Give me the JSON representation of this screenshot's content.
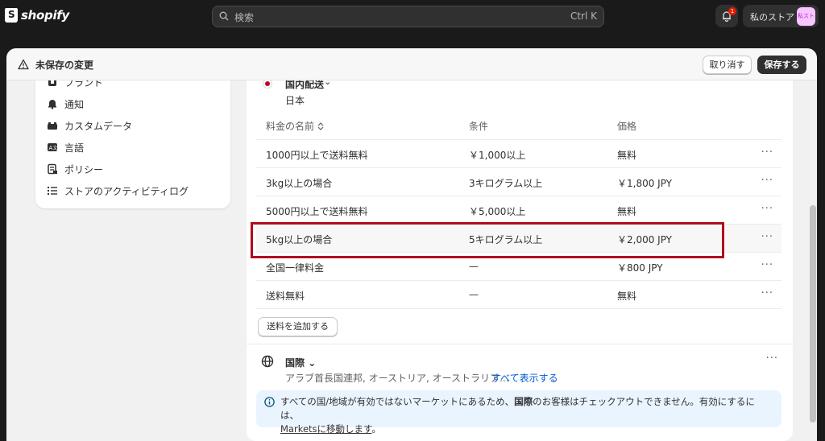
{
  "topbar": {
    "logo_text": "shopify",
    "search_placeholder": "検索",
    "search_shortcut": "Ctrl K",
    "notification_count": "1",
    "store_name": "私のストア",
    "store_avatar": "私スト"
  },
  "unsaved": {
    "title": "未保存の変更",
    "discard_label": "取り消す",
    "save_label": "保存する"
  },
  "sidebar": {
    "items": [
      {
        "label": "ブランド",
        "icon": "brand-icon"
      },
      {
        "label": "通知",
        "icon": "bell-icon"
      },
      {
        "label": "カスタムデータ",
        "icon": "custom-data-icon"
      },
      {
        "label": "言語",
        "icon": "language-icon"
      },
      {
        "label": "ポリシー",
        "icon": "policy-icon"
      },
      {
        "label": "ストアのアクティビティログ",
        "icon": "list-icon"
      }
    ]
  },
  "domestic": {
    "title": "国内配送",
    "country": "日本"
  },
  "table": {
    "headers": {
      "name": "料金の名前",
      "condition": "条件",
      "price": "価格"
    },
    "rows": [
      {
        "name": "1000円以上で送料無料",
        "condition": "￥1,000以上",
        "price": "無料"
      },
      {
        "name": "3kg以上の場合",
        "condition": "3キログラム以上",
        "price": "￥1,800 JPY"
      },
      {
        "name": "5000円以上で送料無料",
        "condition": "￥5,000以上",
        "price": "無料"
      },
      {
        "name": "5kg以上の場合",
        "condition": "5キログラム以上",
        "price": "￥2,000 JPY"
      },
      {
        "name": "全国一律料金",
        "condition": "—",
        "price": "￥800 JPY"
      },
      {
        "name": "送料無料",
        "condition": "—",
        "price": "無料"
      }
    ],
    "more_glyph": "···",
    "add_rate_label": "送料を追加する"
  },
  "international": {
    "title": "国際",
    "countries": "アラブ首長国連邦, オーストリア, オーストラリア...",
    "show_all": "すべて表示する"
  },
  "banner": {
    "text_before": "すべての国/地域が有効ではないマーケットにあるため、",
    "text_bold": "国際",
    "text_after": "のお客様はチェックアウトできません。有効にするには、",
    "link": "Marketsに移動します",
    "text_end": "。"
  },
  "colors": {
    "highlight": "#b00b1e",
    "accent_link": "#005bd3",
    "save_bg": "#303030"
  }
}
